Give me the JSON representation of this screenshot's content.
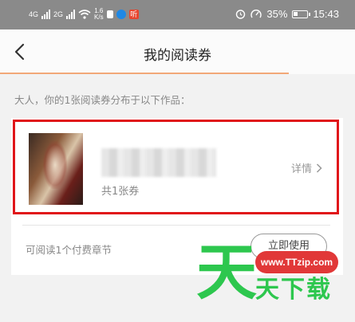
{
  "status_bar": {
    "net1": "4G",
    "net2": "2G",
    "speed_value": "1.6",
    "speed_unit": "K/s",
    "app_badge": "听",
    "battery": "35%",
    "time": "15:43",
    "battery_level": 0.35
  },
  "header": {
    "title": "我的阅读券"
  },
  "subtitle": "大人，你的1张阅读券分布于以下作品：",
  "book": {
    "count": "共1张券",
    "details": "详情"
  },
  "chapters_text": "可阅读1个付费章节",
  "use_button": "立即使用",
  "watermark": {
    "big": "天",
    "url": "www.TTzip.com",
    "small": "天下载"
  },
  "colors": {
    "highlight_border": "#e0161a",
    "accent_line": "#f2a878",
    "watermark_green": "#2dc74e",
    "watermark_red": "#e13838"
  },
  "icons": {
    "back": "chevron-left-icon",
    "details": "chevron-right-icon"
  }
}
